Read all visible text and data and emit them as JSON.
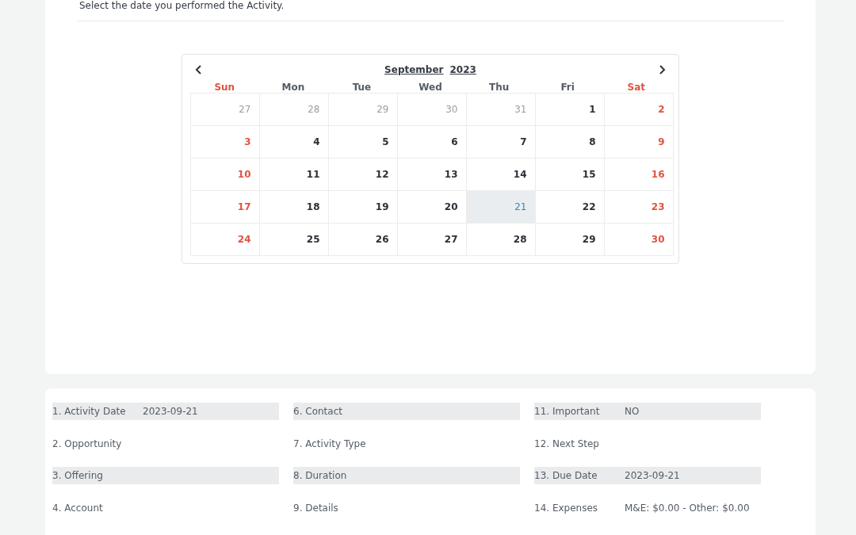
{
  "instruction": "Select the date you performed the Activity.",
  "calendar": {
    "month": "September",
    "year": "2023",
    "weekdays": [
      {
        "label": "Sun",
        "weekend": true
      },
      {
        "label": "Mon",
        "weekend": false
      },
      {
        "label": "Tue",
        "weekend": false
      },
      {
        "label": "Wed",
        "weekend": false
      },
      {
        "label": "Thu",
        "weekend": false
      },
      {
        "label": "Fri",
        "weekend": false
      },
      {
        "label": "Sat",
        "weekend": true
      }
    ],
    "weeks": [
      [
        {
          "day": "27",
          "other_month": true,
          "selected": false
        },
        {
          "day": "28",
          "other_month": true,
          "selected": false
        },
        {
          "day": "29",
          "other_month": true,
          "selected": false
        },
        {
          "day": "30",
          "other_month": true,
          "selected": false
        },
        {
          "day": "31",
          "other_month": true,
          "selected": false
        },
        {
          "day": "1",
          "other_month": false,
          "selected": false
        },
        {
          "day": "2",
          "other_month": false,
          "selected": false
        }
      ],
      [
        {
          "day": "3",
          "other_month": false,
          "selected": false
        },
        {
          "day": "4",
          "other_month": false,
          "selected": false
        },
        {
          "day": "5",
          "other_month": false,
          "selected": false
        },
        {
          "day": "6",
          "other_month": false,
          "selected": false
        },
        {
          "day": "7",
          "other_month": false,
          "selected": false
        },
        {
          "day": "8",
          "other_month": false,
          "selected": false
        },
        {
          "day": "9",
          "other_month": false,
          "selected": false
        }
      ],
      [
        {
          "day": "10",
          "other_month": false,
          "selected": false
        },
        {
          "day": "11",
          "other_month": false,
          "selected": false
        },
        {
          "day": "12",
          "other_month": false,
          "selected": false
        },
        {
          "day": "13",
          "other_month": false,
          "selected": false
        },
        {
          "day": "14",
          "other_month": false,
          "selected": false
        },
        {
          "day": "15",
          "other_month": false,
          "selected": false
        },
        {
          "day": "16",
          "other_month": false,
          "selected": false
        }
      ],
      [
        {
          "day": "17",
          "other_month": false,
          "selected": false
        },
        {
          "day": "18",
          "other_month": false,
          "selected": false
        },
        {
          "day": "19",
          "other_month": false,
          "selected": false
        },
        {
          "day": "20",
          "other_month": false,
          "selected": false
        },
        {
          "day": "21",
          "other_month": false,
          "selected": true
        },
        {
          "day": "22",
          "other_month": false,
          "selected": false
        },
        {
          "day": "23",
          "other_month": false,
          "selected": false
        }
      ],
      [
        {
          "day": "24",
          "other_month": false,
          "selected": false
        },
        {
          "day": "25",
          "other_month": false,
          "selected": false
        },
        {
          "day": "26",
          "other_month": false,
          "selected": false
        },
        {
          "day": "27",
          "other_month": false,
          "selected": false
        },
        {
          "day": "28",
          "other_month": false,
          "selected": false
        },
        {
          "day": "29",
          "other_month": false,
          "selected": false
        },
        {
          "day": "30",
          "other_month": false,
          "selected": false
        }
      ]
    ]
  },
  "summary": {
    "columns": [
      [
        {
          "label": "1. Activity Date",
          "value": "2023-09-21"
        },
        {
          "label": "2. Opportunity"
        },
        {
          "label": "3. Offering"
        },
        {
          "label": "4. Account"
        }
      ],
      [
        {
          "label": "6. Contact"
        },
        {
          "label": "7. Activity Type"
        },
        {
          "label": "8. Duration"
        },
        {
          "label": "9. Details"
        }
      ],
      [
        {
          "label": "11. Important",
          "value": "NO"
        },
        {
          "label": "12. Next Step"
        },
        {
          "label": "13. Due Date",
          "value": "2023-09-21"
        },
        {
          "label": "14. Expenses",
          "value": "M&E: $0.00 - Other: $0.00"
        }
      ]
    ]
  }
}
